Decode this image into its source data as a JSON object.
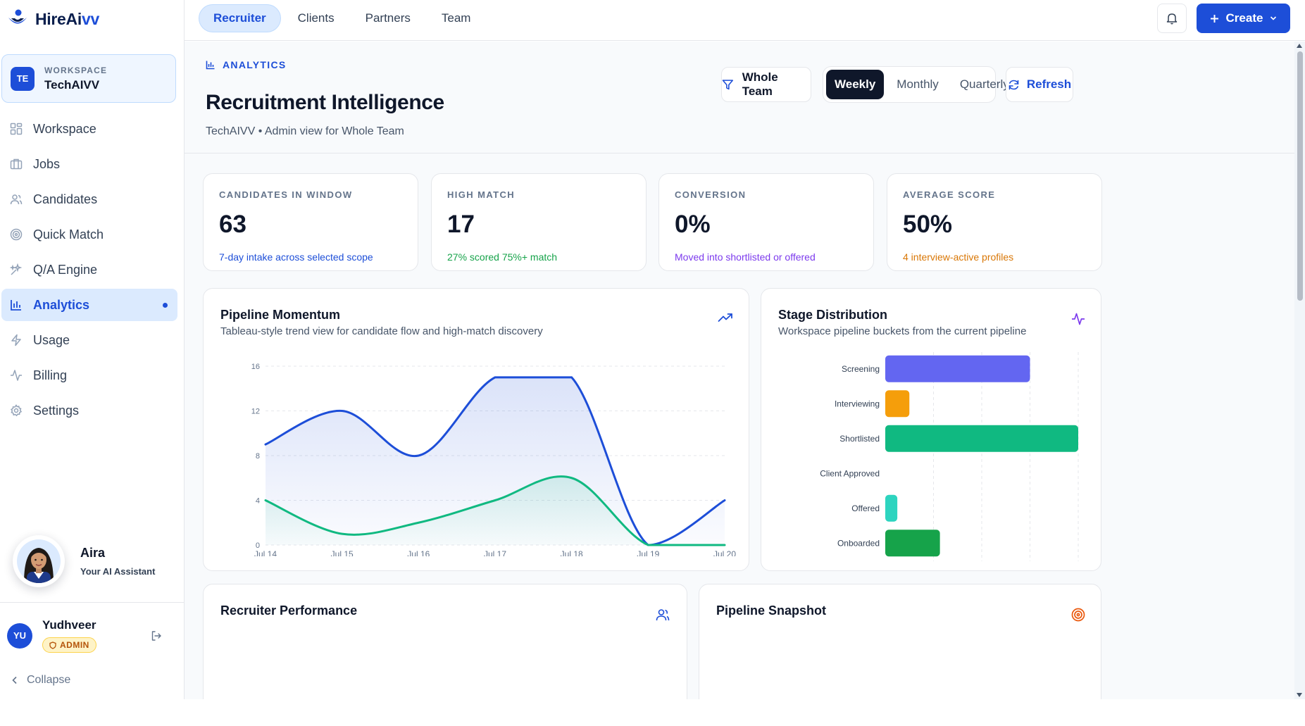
{
  "brand": {
    "name_main": "HireAi",
    "name_accent": "vv"
  },
  "workspace": {
    "label": "WORKSPACE",
    "badge": "TE",
    "name": "TechAIVV"
  },
  "sidebar": {
    "items": [
      {
        "label": "Workspace",
        "icon": "grid-icon"
      },
      {
        "label": "Jobs",
        "icon": "briefcase-icon"
      },
      {
        "label": "Candidates",
        "icon": "users-icon"
      },
      {
        "label": "Quick Match",
        "icon": "target-icon"
      },
      {
        "label": "Q/A Engine",
        "icon": "sparkles-icon"
      },
      {
        "label": "Analytics",
        "icon": "bar-chart-icon",
        "active": true
      },
      {
        "label": "Usage",
        "icon": "zap-icon"
      },
      {
        "label": "Billing",
        "icon": "activity-icon"
      },
      {
        "label": "Settings",
        "icon": "gear-icon"
      }
    ]
  },
  "assistant": {
    "name": "Aira",
    "subtitle": "Your AI Assistant"
  },
  "user": {
    "badge": "YU",
    "name": "Yudhveer",
    "role": "ADMIN"
  },
  "collapse_label": "Collapse",
  "topbar": {
    "tabs": [
      "Recruiter",
      "Clients",
      "Partners",
      "Team"
    ],
    "active_tab": "Recruiter",
    "create_label": "Create"
  },
  "header": {
    "eyebrow": "ANALYTICS",
    "title": "Recruitment Intelligence",
    "subtitle": "TechAIVV • Admin view for Whole Team",
    "filter_label": "Whole Team",
    "periods": [
      "Weekly",
      "Monthly",
      "Quarterly"
    ],
    "active_period": "Weekly",
    "refresh_label": "Refresh"
  },
  "kpis": [
    {
      "label": "CANDIDATES IN WINDOW",
      "value": "63",
      "note": "7-day intake across selected scope",
      "note_color": "#1d4ed8"
    },
    {
      "label": "HIGH MATCH",
      "value": "17",
      "note": "27% scored 75%+ match",
      "note_color": "#16a34a"
    },
    {
      "label": "CONVERSION",
      "value": "0%",
      "note": "Moved into shortlisted or offered",
      "note_color": "#7c3aed"
    },
    {
      "label": "AVERAGE SCORE",
      "value": "50%",
      "note": "4 interview-active profiles",
      "note_color": "#d97706"
    }
  ],
  "panels": {
    "momentum": {
      "title": "Pipeline Momentum",
      "subtitle": "Tableau-style trend view for candidate flow and high-match discovery"
    },
    "stages": {
      "title": "Stage Distribution",
      "subtitle": "Workspace pipeline buckets from the current pipeline"
    },
    "recruiter": {
      "title": "Recruiter Performance"
    },
    "snapshot": {
      "title": "Pipeline Snapshot"
    }
  },
  "chart_data": [
    {
      "type": "area",
      "x": [
        "Jul 14",
        "Jul 15",
        "Jul 16",
        "Jul 17",
        "Jul 18",
        "Jul 19",
        "Jul 20"
      ],
      "ylim": [
        0,
        16
      ],
      "yticks": [
        0,
        4,
        8,
        12,
        16
      ],
      "grid": true,
      "series": [
        {
          "values": [
            9,
            12,
            8,
            15,
            15,
            0,
            4
          ],
          "color": "#1d4ed8"
        },
        {
          "values": [
            4,
            1,
            2,
            4,
            6,
            0,
            0
          ],
          "color": "#10b981"
        }
      ]
    },
    {
      "type": "bar",
      "orientation": "horizontal",
      "categories": [
        "Screening",
        "Interviewing",
        "Shortlisted",
        "Client Approved",
        "Offered",
        "Onboarded"
      ],
      "values": [
        18,
        3,
        24,
        0,
        1.5,
        6.8
      ],
      "xlim": [
        0,
        24
      ],
      "colors": [
        "#6366f1",
        "#f59e0b",
        "#10b981",
        "#94a3b8",
        "#2dd4bf",
        "#16a34a"
      ]
    }
  ]
}
